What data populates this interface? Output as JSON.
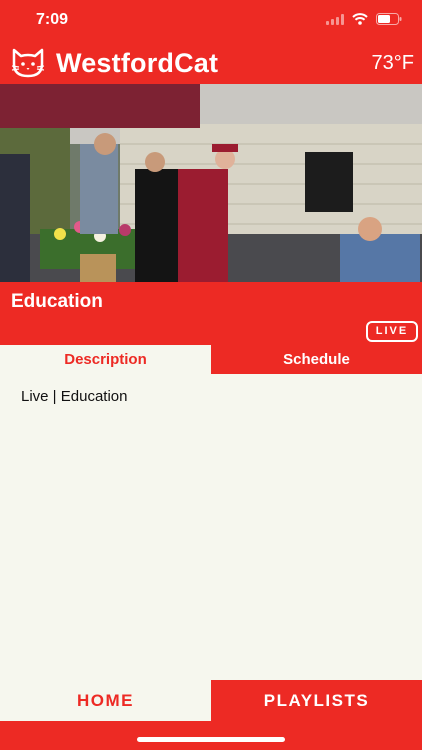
{
  "status_bar": {
    "time": "7:09"
  },
  "header": {
    "title": "WestfordCat",
    "temperature": "73°F"
  },
  "video": {
    "title": "Education",
    "live_badge": "LIVE"
  },
  "tabs": [
    {
      "label": "Description",
      "active": true
    },
    {
      "label": "Schedule",
      "active": false
    }
  ],
  "content": {
    "description": "Live | Education"
  },
  "bottom_nav": [
    {
      "label": "HOME",
      "active": true
    },
    {
      "label": "PLAYLISTS",
      "active": false
    }
  ],
  "colors": {
    "brand_red": "#ED2A24",
    "panel_bg": "#F6F7EE"
  },
  "icons": [
    "cat-logo-icon",
    "signal-icon",
    "wifi-icon",
    "battery-icon"
  ]
}
